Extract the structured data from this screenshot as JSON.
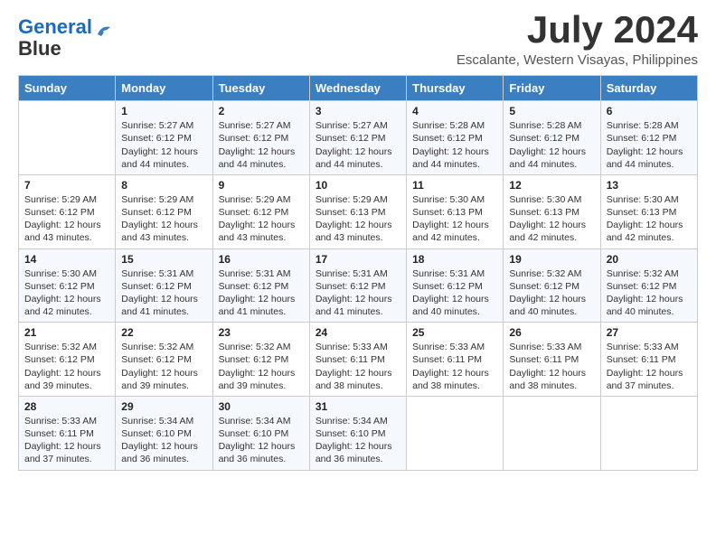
{
  "header": {
    "logo_line1": "General",
    "logo_line2": "Blue",
    "month_title": "July 2024",
    "location": "Escalante, Western Visayas, Philippines"
  },
  "weekdays": [
    "Sunday",
    "Monday",
    "Tuesday",
    "Wednesday",
    "Thursday",
    "Friday",
    "Saturday"
  ],
  "weeks": [
    [
      {
        "day": "",
        "info": ""
      },
      {
        "day": "1",
        "info": "Sunrise: 5:27 AM\nSunset: 6:12 PM\nDaylight: 12 hours and 44 minutes."
      },
      {
        "day": "2",
        "info": "Sunrise: 5:27 AM\nSunset: 6:12 PM\nDaylight: 12 hours and 44 minutes."
      },
      {
        "day": "3",
        "info": "Sunrise: 5:27 AM\nSunset: 6:12 PM\nDaylight: 12 hours and 44 minutes."
      },
      {
        "day": "4",
        "info": "Sunrise: 5:28 AM\nSunset: 6:12 PM\nDaylight: 12 hours and 44 minutes."
      },
      {
        "day": "5",
        "info": "Sunrise: 5:28 AM\nSunset: 6:12 PM\nDaylight: 12 hours and 44 minutes."
      },
      {
        "day": "6",
        "info": "Sunrise: 5:28 AM\nSunset: 6:12 PM\nDaylight: 12 hours and 44 minutes."
      }
    ],
    [
      {
        "day": "7",
        "info": "Sunrise: 5:29 AM\nSunset: 6:12 PM\nDaylight: 12 hours and 43 minutes."
      },
      {
        "day": "8",
        "info": "Sunrise: 5:29 AM\nSunset: 6:12 PM\nDaylight: 12 hours and 43 minutes."
      },
      {
        "day": "9",
        "info": "Sunrise: 5:29 AM\nSunset: 6:12 PM\nDaylight: 12 hours and 43 minutes."
      },
      {
        "day": "10",
        "info": "Sunrise: 5:29 AM\nSunset: 6:13 PM\nDaylight: 12 hours and 43 minutes."
      },
      {
        "day": "11",
        "info": "Sunrise: 5:30 AM\nSunset: 6:13 PM\nDaylight: 12 hours and 42 minutes."
      },
      {
        "day": "12",
        "info": "Sunrise: 5:30 AM\nSunset: 6:13 PM\nDaylight: 12 hours and 42 minutes."
      },
      {
        "day": "13",
        "info": "Sunrise: 5:30 AM\nSunset: 6:13 PM\nDaylight: 12 hours and 42 minutes."
      }
    ],
    [
      {
        "day": "14",
        "info": "Sunrise: 5:30 AM\nSunset: 6:12 PM\nDaylight: 12 hours and 42 minutes."
      },
      {
        "day": "15",
        "info": "Sunrise: 5:31 AM\nSunset: 6:12 PM\nDaylight: 12 hours and 41 minutes."
      },
      {
        "day": "16",
        "info": "Sunrise: 5:31 AM\nSunset: 6:12 PM\nDaylight: 12 hours and 41 minutes."
      },
      {
        "day": "17",
        "info": "Sunrise: 5:31 AM\nSunset: 6:12 PM\nDaylight: 12 hours and 41 minutes."
      },
      {
        "day": "18",
        "info": "Sunrise: 5:31 AM\nSunset: 6:12 PM\nDaylight: 12 hours and 40 minutes."
      },
      {
        "day": "19",
        "info": "Sunrise: 5:32 AM\nSunset: 6:12 PM\nDaylight: 12 hours and 40 minutes."
      },
      {
        "day": "20",
        "info": "Sunrise: 5:32 AM\nSunset: 6:12 PM\nDaylight: 12 hours and 40 minutes."
      }
    ],
    [
      {
        "day": "21",
        "info": "Sunrise: 5:32 AM\nSunset: 6:12 PM\nDaylight: 12 hours and 39 minutes."
      },
      {
        "day": "22",
        "info": "Sunrise: 5:32 AM\nSunset: 6:12 PM\nDaylight: 12 hours and 39 minutes."
      },
      {
        "day": "23",
        "info": "Sunrise: 5:32 AM\nSunset: 6:12 PM\nDaylight: 12 hours and 39 minutes."
      },
      {
        "day": "24",
        "info": "Sunrise: 5:33 AM\nSunset: 6:11 PM\nDaylight: 12 hours and 38 minutes."
      },
      {
        "day": "25",
        "info": "Sunrise: 5:33 AM\nSunset: 6:11 PM\nDaylight: 12 hours and 38 minutes."
      },
      {
        "day": "26",
        "info": "Sunrise: 5:33 AM\nSunset: 6:11 PM\nDaylight: 12 hours and 38 minutes."
      },
      {
        "day": "27",
        "info": "Sunrise: 5:33 AM\nSunset: 6:11 PM\nDaylight: 12 hours and 37 minutes."
      }
    ],
    [
      {
        "day": "28",
        "info": "Sunrise: 5:33 AM\nSunset: 6:11 PM\nDaylight: 12 hours and 37 minutes."
      },
      {
        "day": "29",
        "info": "Sunrise: 5:34 AM\nSunset: 6:10 PM\nDaylight: 12 hours and 36 minutes."
      },
      {
        "day": "30",
        "info": "Sunrise: 5:34 AM\nSunset: 6:10 PM\nDaylight: 12 hours and 36 minutes."
      },
      {
        "day": "31",
        "info": "Sunrise: 5:34 AM\nSunset: 6:10 PM\nDaylight: 12 hours and 36 minutes."
      },
      {
        "day": "",
        "info": ""
      },
      {
        "day": "",
        "info": ""
      },
      {
        "day": "",
        "info": ""
      }
    ]
  ]
}
